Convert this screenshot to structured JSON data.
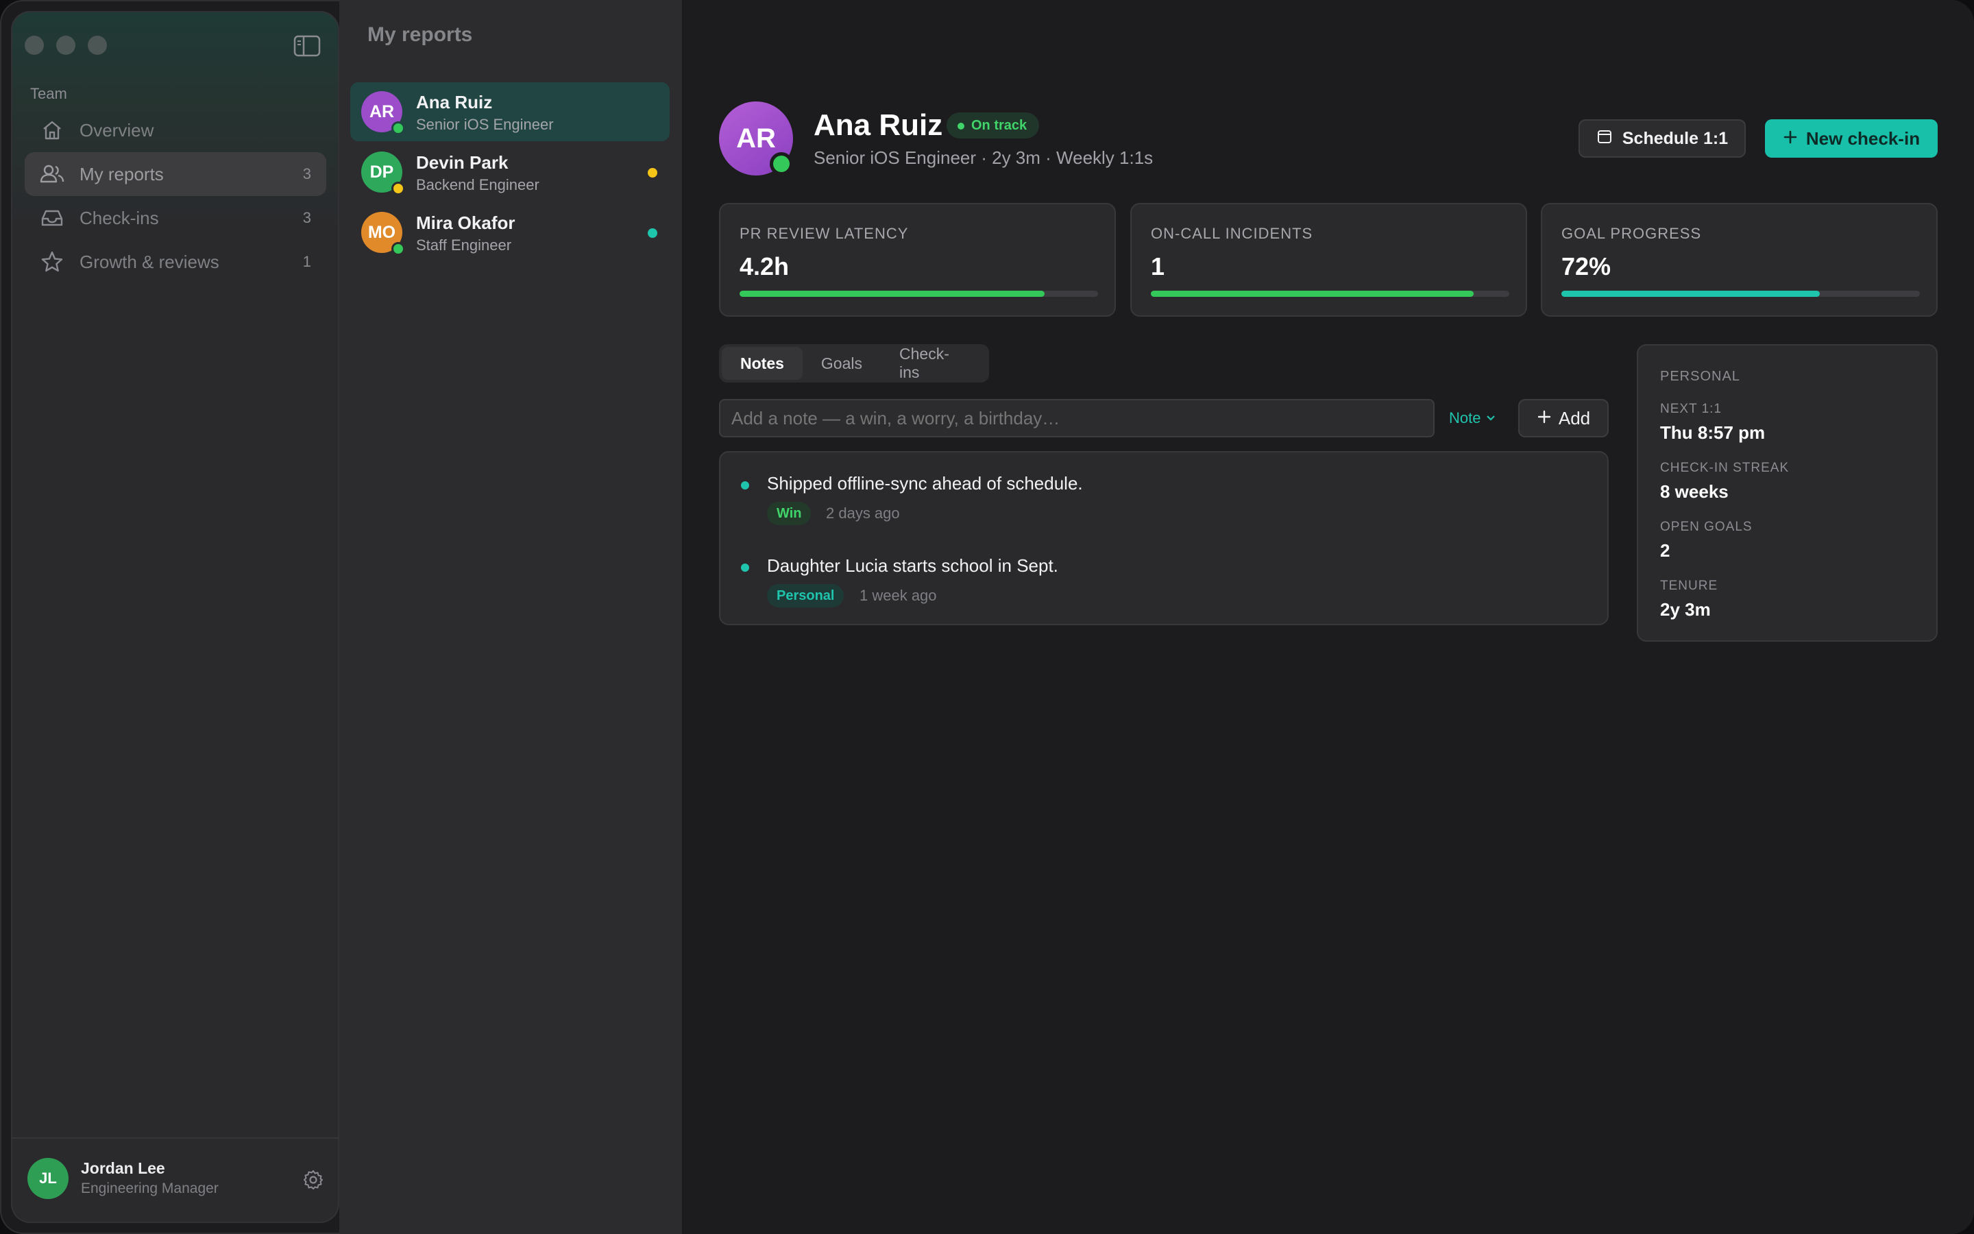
{
  "sidebar": {
    "section_label": "Team",
    "items": [
      {
        "label": "Overview",
        "icon": "home-icon",
        "count": ""
      },
      {
        "label": "My reports",
        "icon": "people-icon",
        "count": "3"
      },
      {
        "label": "Check-ins",
        "icon": "inbox-icon",
        "count": "3"
      },
      {
        "label": "Growth & reviews",
        "icon": "star-icon",
        "count": "1"
      }
    ],
    "active_item": "My reports",
    "user": {
      "initials": "JL",
      "name": "Jordan Lee",
      "role": "Engineering Manager"
    }
  },
  "reports": {
    "title": "My reports",
    "items": [
      {
        "initials": "AR",
        "name": "Ana Ruiz",
        "role": "Senior iOS Engineer",
        "avatar_color": "#9b4dca",
        "presence_color": "#34c759",
        "indicator_color": ""
      },
      {
        "initials": "DP",
        "name": "Devin Park",
        "role": "Backend Engineer",
        "avatar_color": "#2ea85a",
        "presence_color": "#f5c518",
        "indicator_color": "#f5c518"
      },
      {
        "initials": "MO",
        "name": "Mira Okafor",
        "role": "Staff Engineer",
        "avatar_color": "#e08a2a",
        "presence_color": "#34c759",
        "indicator_color": "#1fc4ad"
      }
    ],
    "selected": "Ana Ruiz"
  },
  "profile": {
    "initials": "AR",
    "name": "Ana Ruiz",
    "status": "On track",
    "subtitle": "Senior iOS Engineer · 2y 3m · Weekly 1:1s",
    "schedule_label": "Schedule 1:1",
    "new_checkin_label": "New check-in"
  },
  "metrics": [
    {
      "label": "PR REVIEW LATENCY",
      "value": "4.2h",
      "progress": 0.85,
      "color": "#34c759"
    },
    {
      "label": "ON-CALL INCIDENTS",
      "value": "1",
      "progress": 0.9,
      "color": "#34c759"
    },
    {
      "label": "GOAL PROGRESS",
      "value": "72%",
      "progress": 0.72,
      "color": "#1fc4ad"
    }
  ],
  "tabs": [
    {
      "label": "Notes",
      "active": true
    },
    {
      "label": "Goals",
      "active": false
    },
    {
      "label": "Check-ins",
      "active": false
    }
  ],
  "composer": {
    "placeholder": "Add a note — a win, a worry, a birthday…",
    "type_label": "Note",
    "add_label": "Add"
  },
  "notes": [
    {
      "text": "Shipped offline-sync ahead of schedule.",
      "tag": "Win",
      "tag_color": "#40d46a",
      "tag_bg": "#233a2b",
      "time": "2 days ago"
    },
    {
      "text": "Daughter Lucia starts school in Sept.",
      "tag": "Personal",
      "tag_color": "#1fc4ad",
      "tag_bg": "#1e3a37",
      "time": "1 week ago"
    }
  ],
  "personal": {
    "heading": "PERSONAL",
    "stats": [
      {
        "label": "NEXT 1:1",
        "value": "Thu 8:57 pm"
      },
      {
        "label": "CHECK-IN STREAK",
        "value": "8 weeks"
      },
      {
        "label": "OPEN GOALS",
        "value": "2"
      },
      {
        "label": "TENURE",
        "value": "2y 3m"
      }
    ]
  }
}
